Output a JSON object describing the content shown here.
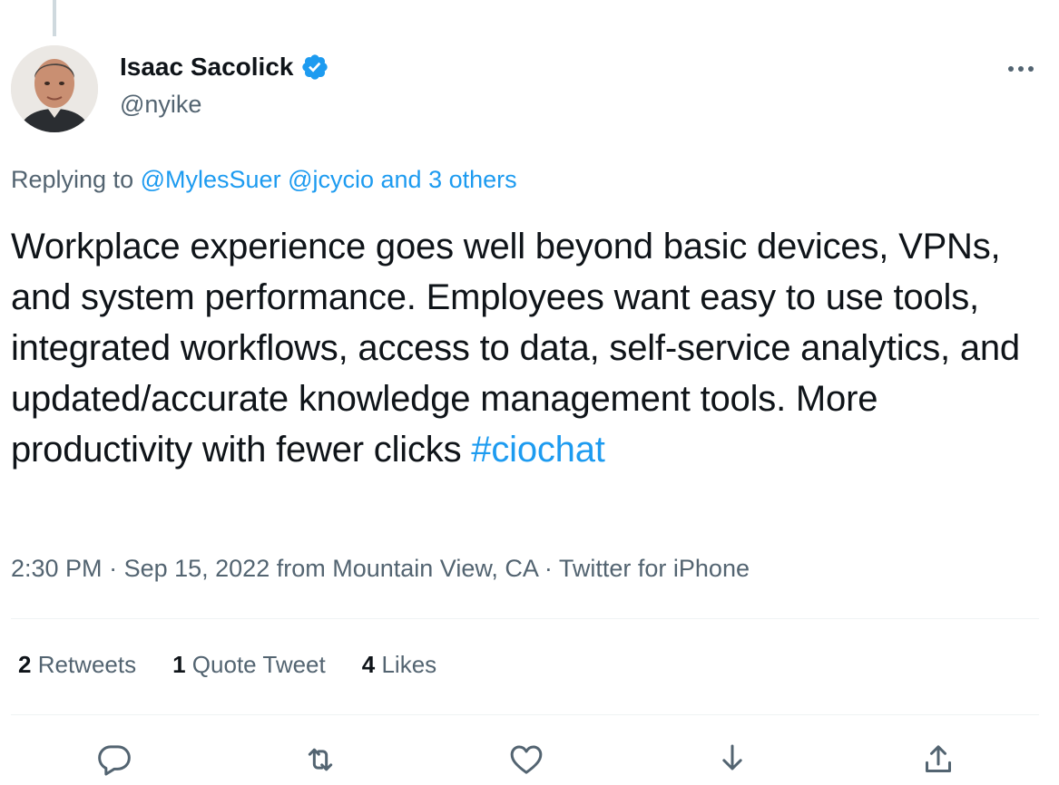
{
  "author": {
    "display_name": "Isaac Sacolick",
    "handle": "@nyike",
    "verified": true
  },
  "reply_context": {
    "prefix": "Replying to",
    "users": [
      "@MylesSuer",
      "@jcycio"
    ],
    "others": "and 3 others"
  },
  "tweet": {
    "text": "Workplace experience goes well beyond basic devices, VPNs, and system performance. Employees want easy to use tools, integrated workflows, access to data, self-service analytics, and updated/accurate knowledge management tools. More productivity with fewer clicks",
    "hashtag": "#ciochat"
  },
  "meta": {
    "time": "2:30 PM",
    "sep1": " · ",
    "date": "Sep 15, 2022",
    "location": " from Mountain View, CA",
    "sep2": " · ",
    "source": "Twitter for iPhone"
  },
  "stats": {
    "retweets_count": "2",
    "retweets_label": "Retweets",
    "quotes_count": "1",
    "quotes_label": "Quote Tweet",
    "likes_count": "4",
    "likes_label": "Likes"
  },
  "colors": {
    "accent": "#1d9bf0",
    "secondary_text": "#536471",
    "primary_text": "#0f1419",
    "divider": "#eff3f4"
  },
  "icons": {
    "more": "more-horizontal-icon",
    "reply": "reply-icon",
    "retweet": "retweet-icon",
    "like": "heart-icon",
    "bookmark": "bookmark-download-icon",
    "share": "share-icon"
  }
}
